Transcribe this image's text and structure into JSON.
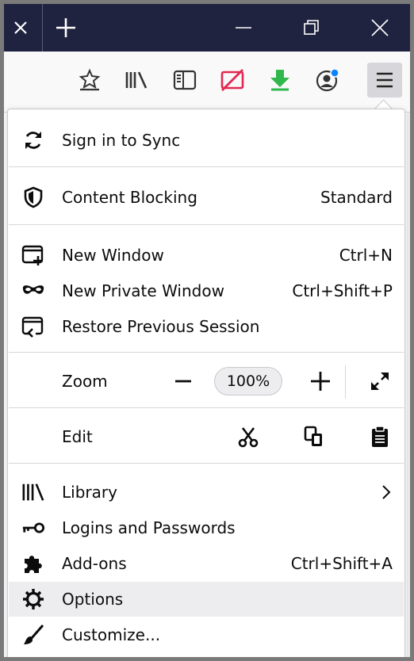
{
  "menu": {
    "sync": {
      "label": "Sign in to Sync",
      "icon": "sync-icon"
    },
    "content_blocking": {
      "label": "Content Blocking",
      "value": "Standard",
      "icon": "shield-icon"
    },
    "new_window": {
      "label": "New Window",
      "shortcut": "Ctrl+N",
      "icon": "new-window-icon"
    },
    "new_private_window": {
      "label": "New Private Window",
      "shortcut": "Ctrl+Shift+P",
      "icon": "private-mask-icon"
    },
    "restore_session": {
      "label": "Restore Previous Session",
      "icon": "restore-session-icon"
    },
    "zoom": {
      "label": "Zoom",
      "value": "100%"
    },
    "edit": {
      "label": "Edit"
    },
    "library": {
      "label": "Library",
      "icon": "library-icon"
    },
    "logins": {
      "label": "Logins and Passwords",
      "icon": "key-icon"
    },
    "addons": {
      "label": "Add-ons",
      "shortcut": "Ctrl+Shift+A",
      "icon": "puzzle-icon"
    },
    "options": {
      "label": "Options",
      "icon": "gear-icon"
    },
    "customize": {
      "label": "Customize...",
      "icon": "paintbrush-icon"
    }
  },
  "colors": {
    "titlebar": "#202340",
    "hover": "#ededf0",
    "accent_red": "#e22850",
    "accent_green": "#30b84c",
    "accent_blue": "#0a84ff"
  }
}
